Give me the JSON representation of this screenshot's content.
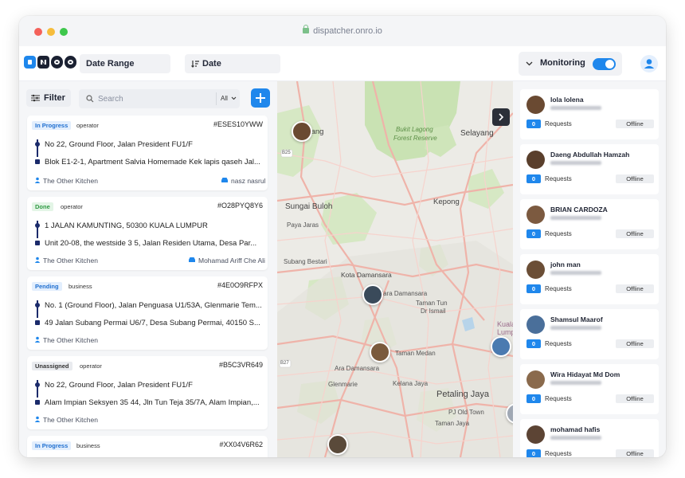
{
  "browser": {
    "url": "dispatcher.onro.io"
  },
  "topbar": {
    "date_range_label": "Date Range",
    "date_label": "Date",
    "monitoring_label": "Monitoring",
    "monitoring_on": true
  },
  "filters": {
    "filter_label": "Filter",
    "search_placeholder": "Search",
    "search_scope": "All"
  },
  "orders": [
    {
      "status": "In Progress",
      "type": "operator",
      "id": "#ESES10YWW",
      "pickup": "No 22, Ground Floor, Jalan President FU1/F",
      "dropoff": "Blok E1-2-1, Apartment Salvia Homemade Kek lapis qaseh Jal...",
      "customer": "The Other Kitchen",
      "driver": "nasz nasrul"
    },
    {
      "status": "Done",
      "type": "operator",
      "id": "#O28PYQ8Y6",
      "pickup": "1 JALAN KAMUNTING, 50300 KUALA LUMPUR",
      "dropoff": "Unit 20-08, the westside 3 5, Jalan Residen Utama, Desa Par...",
      "customer": "The Other Kitchen",
      "driver": "Mohamad Ariff Che Ali"
    },
    {
      "status": "Pending",
      "type": "business",
      "id": "#4E0O9RFPX",
      "pickup": "No. 1 (Ground Floor), Jalan Penguasa U1/53A, Glenmarie Tem...",
      "dropoff": "49 Jalan Subang Permai U6/7, Desa Subang Permai, 40150 S...",
      "customer": "The Other Kitchen",
      "driver": ""
    },
    {
      "status": "Unassigned",
      "type": "operator",
      "id": "#B5C3VR649",
      "pickup": "No 22, Ground Floor, Jalan President FU1/F",
      "dropoff": "Alam Impian Seksyen 35 44, Jln Tun Teja 35/7A, Alam Impian,...",
      "customer": "The Other Kitchen",
      "driver": ""
    },
    {
      "status": "In Progress",
      "type": "business",
      "id": "#XX04V6R62",
      "pickup": "",
      "dropoff": "",
      "customer": "",
      "driver": ""
    }
  ],
  "map": {
    "labels": [
      "Kuang",
      "Bukit Lagong",
      "Forest Reserve",
      "Selayang",
      "Sungai Buloh",
      "Kepong",
      "Paya Jaras",
      "Subang Bestari",
      "Kota Damansara",
      "Mutiara Damansara",
      "Taman Tun",
      "Dr Ismail",
      "Kelana Jaya",
      "Ara Damansara",
      "Petaling Jaya",
      "PJ Old Town",
      "Glenmarie",
      "Taman Jaya",
      "Taman Medan",
      "Kuala Lumpur"
    ],
    "road_labels": [
      "B25",
      "B27"
    ]
  },
  "drivers": [
    {
      "name": "lola lolena",
      "requests": "0",
      "requests_label": "Requests",
      "status": "Offline"
    },
    {
      "name": "Daeng Abdullah Hamzah",
      "requests": "0",
      "requests_label": "Requests",
      "status": "Offline"
    },
    {
      "name": "BRIAN CARDOZA",
      "requests": "0",
      "requests_label": "Requests",
      "status": "Offline"
    },
    {
      "name": "john man",
      "requests": "0",
      "requests_label": "Requests",
      "status": "Offline"
    },
    {
      "name": "Shamsul Maarof",
      "requests": "0",
      "requests_label": "Requests",
      "status": "Offline"
    },
    {
      "name": "Wira Hidayat Md Dom",
      "requests": "0",
      "requests_label": "Requests",
      "status": "Offline"
    },
    {
      "name": "mohamad hafis",
      "requests": "0",
      "requests_label": "Requests",
      "status": "Offline"
    }
  ],
  "colors": {
    "accent": "#1f87ec",
    "inprogress_bg": "#e2eefd",
    "done_bg": "#e3f5e6",
    "pending_bg": "#e2eefd",
    "unassigned_bg": "#e9ebef",
    "map_green": "#c9e2b3",
    "map_road": "#f2c3bd"
  }
}
